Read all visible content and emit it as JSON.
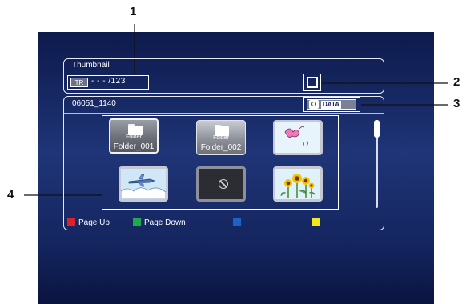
{
  "callouts": [
    "1",
    "2",
    "3",
    "4"
  ],
  "header": {
    "title": "Thumbnail",
    "track_badge": "TR",
    "track_count": "- - - /123"
  },
  "folder_bar": {
    "name": "06051_1140",
    "media_label": "DATA"
  },
  "thumbnails": [
    {
      "kind": "folder",
      "type_label": "Folder",
      "label": "Folder_001",
      "selected": true
    },
    {
      "kind": "folder",
      "type_label": "Folder",
      "label": "Folder_002",
      "selected": false
    },
    {
      "kind": "photo",
      "subject": "butterfly-image"
    },
    {
      "kind": "photo",
      "subject": "airplane-image"
    },
    {
      "kind": "unavailable",
      "subject": "no-image-icon"
    },
    {
      "kind": "photo",
      "subject": "sunflowers-image"
    }
  ],
  "footer": {
    "red_label": "Page Up",
    "green_label": "Page Down",
    "blue_label": "",
    "yellow_label": ""
  },
  "colors": {
    "red": "#e0202a",
    "green": "#1eaa4a",
    "blue": "#1c62c8",
    "yellow": "#f2e81c"
  }
}
